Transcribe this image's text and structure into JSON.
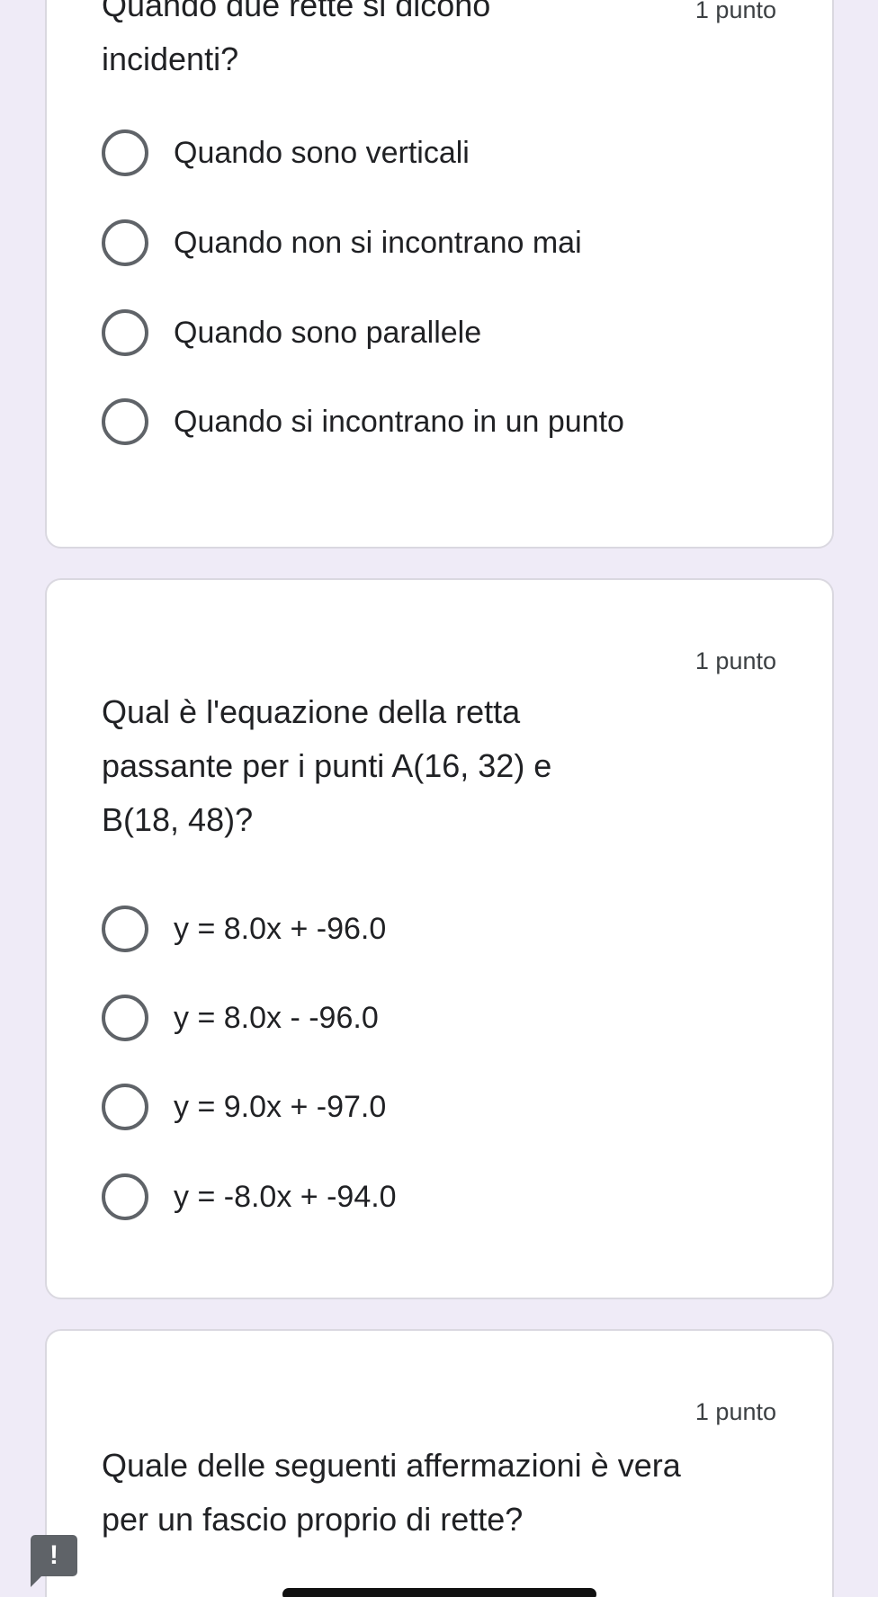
{
  "questions": [
    {
      "points": "1 punto",
      "title": "Quando due rette si dicono incidenti?",
      "options": [
        "Quando sono verticali",
        "Quando non si incontrano mai",
        "Quando sono parallele",
        "Quando si incontrano in un punto"
      ]
    },
    {
      "points": "1 punto",
      "title": "Qual è l'equazione della retta passante per i punti A(16, 32) e B(18, 48)?",
      "options": [
        "y = 8.0x + -96.0",
        "y = 8.0x - -96.0",
        "y = 9.0x + -97.0",
        "y = -8.0x + -94.0"
      ]
    },
    {
      "points": "1 punto",
      "title": "Quale delle seguenti affermazioni è vera per un fascio proprio di rette?"
    }
  ],
  "report_icon": {
    "icon": "exclamation-report-icon",
    "glyph": "!"
  }
}
